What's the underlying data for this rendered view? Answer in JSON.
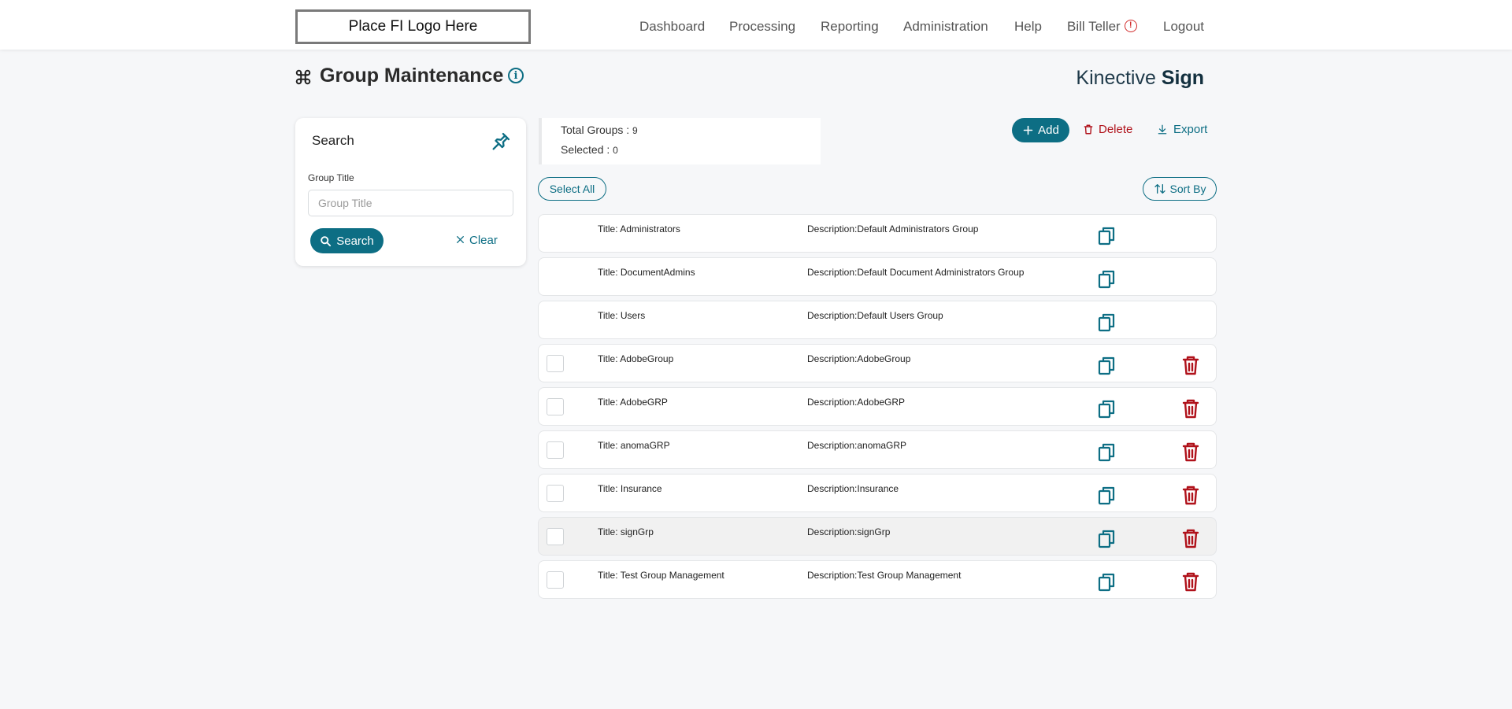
{
  "header": {
    "logo_text": "Place FI Logo Here",
    "nav": [
      "Dashboard",
      "Processing",
      "Reporting",
      "Administration",
      "Help",
      "Bill Teller",
      "Logout"
    ],
    "alert_glyph": "!"
  },
  "page": {
    "title": "Group Maintenance",
    "info_glyph": "i",
    "brand_light": "Kinective",
    "brand_bold": "Sign"
  },
  "search": {
    "panel_title": "Search",
    "field_label": "Group Title",
    "field_placeholder": "Group Title",
    "field_value": "",
    "search_button": "Search",
    "clear_button": "Clear"
  },
  "summary": {
    "total_label": "Total Groups : ",
    "total_value": "9",
    "selected_label": "Selected : ",
    "selected_value": "0"
  },
  "actions": {
    "add": "Add",
    "delete": "Delete",
    "export": "Export",
    "select_all": "Select All",
    "sort_by": "Sort By"
  },
  "rows": [
    {
      "title": "Title: Administrators",
      "description": "Description:Default Administrators Group"
    },
    {
      "title": "Title: DocumentAdmins",
      "description": "Description:Default Document Administrators Group"
    },
    {
      "title": "Title: Users",
      "description": "Description:Default Users Group"
    },
    {
      "title": "Title: AdobeGroup",
      "description": "Description:AdobeGroup"
    },
    {
      "title": "Title: AdobeGRP",
      "description": "Description:AdobeGRP"
    },
    {
      "title": "Title: anomaGRP",
      "description": "Description:anomaGRP"
    },
    {
      "title": "Title: Insurance",
      "description": "Description:Insurance"
    },
    {
      "title": "Title: signGrp",
      "description": "Description:signGrp"
    },
    {
      "title": "Title: Test Group Management",
      "description": "Description:Test Group Management"
    }
  ],
  "colors": {
    "primary": "#0d6e84",
    "danger": "#b0121b",
    "alert": "#d12b2b",
    "row_hover": "#f1f1f1"
  },
  "icons": {
    "title": "command-icon",
    "pin": "pin-icon",
    "copy": "copy-icon",
    "trash": "trash-icon"
  }
}
